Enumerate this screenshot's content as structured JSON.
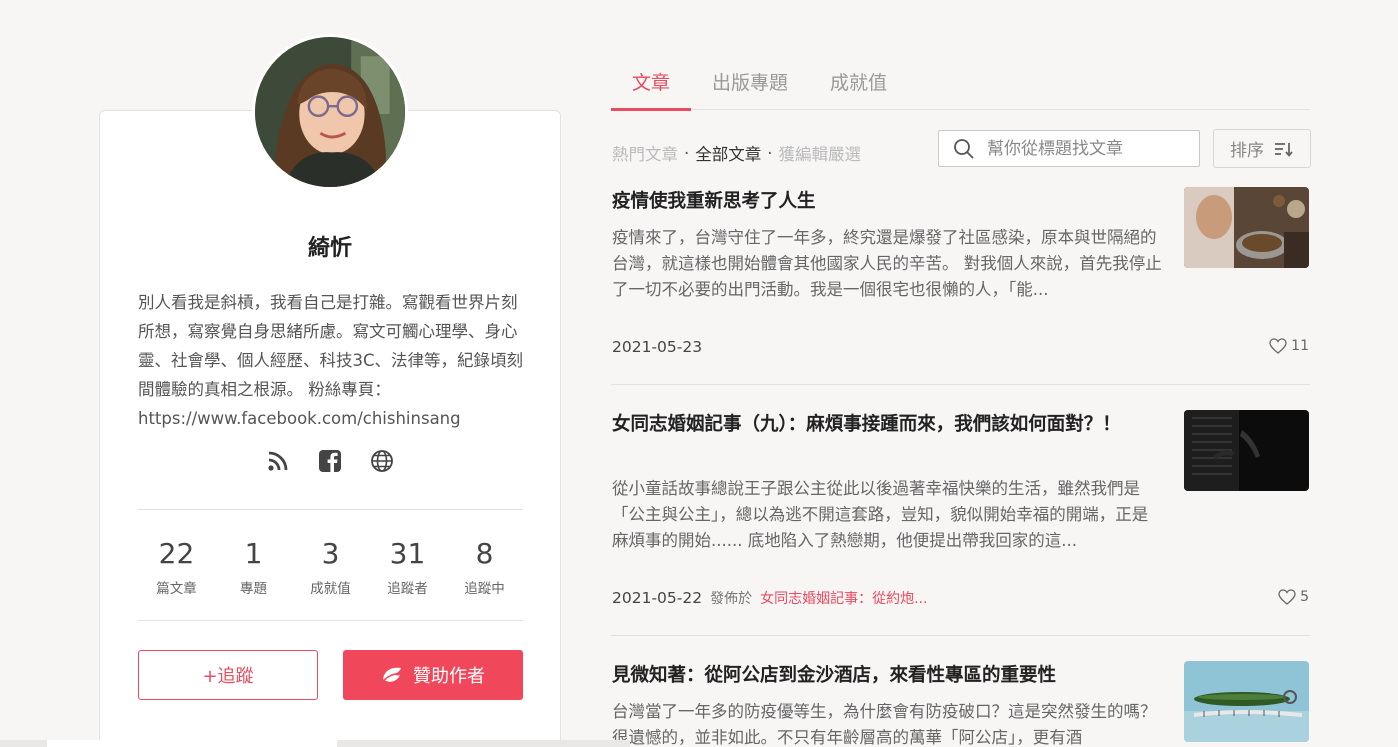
{
  "profile": {
    "name": "綺忻",
    "bio": "別人看我是斜槓，我看自己是打雜。寫觀看世界片刻所想，寫察覺自身思緒所慮。寫文可觸心理學、身心靈、社會學、個人經歷、科技3C、法律等，紀錄頃刻間體驗的真相之根源。 粉絲專頁：https://www.facebook.com/chishinsang",
    "social_icons": [
      "rss-icon",
      "facebook-icon",
      "globe-icon"
    ],
    "stats": [
      {
        "value": "22",
        "label": "篇文章"
      },
      {
        "value": "1",
        "label": "專題"
      },
      {
        "value": "3",
        "label": "成就值"
      },
      {
        "value": "31",
        "label": "追蹤者"
      },
      {
        "value": "8",
        "label": "追蹤中"
      }
    ],
    "follow_label": "+追蹤",
    "sponsor_label": "贊助作者"
  },
  "tabs": [
    {
      "label": "文章",
      "active": true
    },
    {
      "label": "出版專題",
      "active": false
    },
    {
      "label": "成就值",
      "active": false
    }
  ],
  "filters": {
    "hot": "熱門文章",
    "all": "全部文章",
    "editor": "獲編輯嚴選",
    "separator": "·"
  },
  "search": {
    "placeholder": "幫你從標題找文章",
    "value": ""
  },
  "sort": {
    "label": "排序"
  },
  "articles": [
    {
      "title": "疫情使我重新思考了人生",
      "excerpt": "疫情來了，台灣守住了一年多，終究還是爆發了社區感染，原本與世隔絕的台灣，就這樣也開始體會其他國家人民的辛苦。 對我個人來說，首先我停止了一切不必要的出門活動。我是一個很宅也很懶的人，「能...",
      "date": "2021-05-23",
      "published_in_label": "",
      "column": "",
      "likes": "11"
    },
    {
      "title": "女同志婚姻記事（九）：麻煩事接踵而來，我們該如何面對？！",
      "excerpt": "從小童話故事總說王子跟公主從此以後過著幸福快樂的生活，雖然我們是「公主與公主」，總以為逃不開這套路，豈知，貌似開始幸福的開端，正是麻煩事的開始...... 底地陷入了熱戀期，他便提出帶我回家的這...",
      "date": "2021-05-22",
      "published_in_label": "發佈於",
      "column": "女同志婚姻記事：從約炮...",
      "likes": "5"
    },
    {
      "title": "見微知著：從阿公店到金沙酒店，來看性專區的重要性",
      "excerpt": "台灣當了一年多的防疫優等生，為什麼會有防疫破口？這是突然發生的嗎？很遺憾的，並非如此。不只有年齡層高的萬華「阿公店」，更有酒",
      "date": "",
      "published_in_label": "",
      "column": "",
      "likes": ""
    }
  ],
  "colors": {
    "accent": "#e94b5f",
    "sponsor": "#f0475b",
    "background": "#f7f6f5"
  }
}
